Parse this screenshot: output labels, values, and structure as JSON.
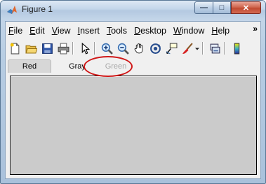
{
  "window": {
    "title": "Figure 1",
    "controls": {
      "minimize": "—",
      "maximize": "□",
      "close": "✕"
    }
  },
  "menubar": {
    "items": [
      {
        "label": "File",
        "accel": "F",
        "rest": "ile"
      },
      {
        "label": "Edit",
        "accel": "E",
        "rest": "dit"
      },
      {
        "label": "View",
        "accel": "V",
        "rest": "iew"
      },
      {
        "label": "Insert",
        "accel": "I",
        "rest": "nsert"
      },
      {
        "label": "Tools",
        "accel": "T",
        "rest": "ools"
      },
      {
        "label": "Desktop",
        "accel": "D",
        "rest": "esktop"
      },
      {
        "label": "Window",
        "accel": "W",
        "rest": "indow"
      },
      {
        "label": "Help",
        "accel": "H",
        "rest": "elp"
      }
    ],
    "overflow": "»"
  },
  "toolbar": {
    "icons": [
      "new-figure-icon",
      "open-file-icon",
      "save-icon",
      "print-icon",
      "edit-plot-arrow-icon",
      "zoom-in-icon",
      "zoom-out-icon",
      "pan-hand-icon",
      "rotate-3d-icon",
      "data-cursor-icon",
      "brush-icon",
      "link-plot-icon",
      "insert-colorbar-icon"
    ]
  },
  "tabs": [
    {
      "label": "Red",
      "state": "selected"
    },
    {
      "label": "Gray",
      "state": "normal"
    },
    {
      "label": "Green",
      "state": "disabled"
    }
  ],
  "colors": {
    "panel_bg": "#cbcbcb",
    "highlight": "#d01818",
    "disabled_text": "#a8a8a8"
  }
}
